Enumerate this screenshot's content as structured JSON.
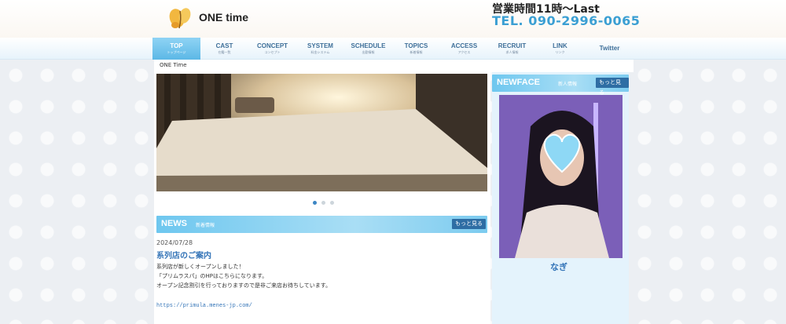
{
  "header": {
    "site_name": "ONE time",
    "hours": "営業時間11時～Last",
    "tel": "TEL. 090-2996-0065"
  },
  "nav": [
    {
      "en": "TOP",
      "jp": "トップページ",
      "active": true
    },
    {
      "en": "CAST",
      "jp": "在籍一覧"
    },
    {
      "en": "CONCEPT",
      "jp": "コンセプト"
    },
    {
      "en": "SYSTEM",
      "jp": "料金システム"
    },
    {
      "en": "SCHEDULE",
      "jp": "出勤情報"
    },
    {
      "en": "TOPICS",
      "jp": "新着情報"
    },
    {
      "en": "ACCESS",
      "jp": "アクセス"
    },
    {
      "en": "RECRUIT",
      "jp": "求人情報"
    },
    {
      "en": "LINK",
      "jp": "リンク"
    },
    {
      "en": "Twitter",
      "jp": ""
    }
  ],
  "breadcrumb": "ONE Time",
  "slider": {
    "dots": 3,
    "active_index": 0
  },
  "news": {
    "heading": "NEWS",
    "subheading": "新着情報",
    "more_label": "もっと見る",
    "date": "2024/07/28",
    "title": "系列店のご案内",
    "body": [
      "系列店が新しくオープンしました！",
      "「プリムラスパ」のHPはこちらになります。",
      "オープン記念割引を行っておりますので是非ご来店お待ちしています。"
    ],
    "link": "https://primula.menes-jp.com/"
  },
  "newface": {
    "heading": "NEWFACE",
    "subheading": "新人情報",
    "more_label": "もっと見る",
    "cast_name": "なぎ"
  },
  "colors": {
    "accent": "#3b9fd3",
    "link": "#3575b8",
    "button": "#2e6da4"
  }
}
